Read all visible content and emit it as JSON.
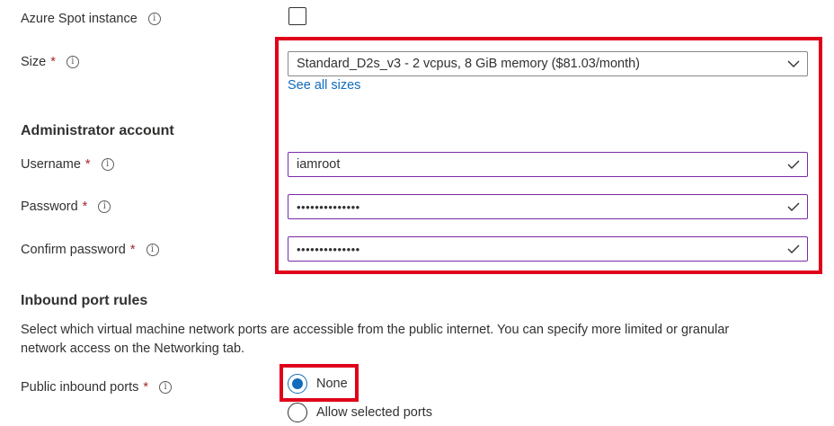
{
  "spot": {
    "label": "Azure Spot instance",
    "checked": false
  },
  "size": {
    "label": "Size",
    "required": "*",
    "value": "Standard_D2s_v3 - 2 vcpus, 8 GiB memory ($81.03/month)",
    "see_all": "See all sizes"
  },
  "admin": {
    "heading": "Administrator account",
    "username": {
      "label": "Username",
      "required": "*",
      "value": "iamroot"
    },
    "password": {
      "label": "Password",
      "required": "*",
      "value": "••••••••••••••"
    },
    "confirm": {
      "label": "Confirm password",
      "required": "*",
      "value": "••••••••••••••"
    }
  },
  "inbound": {
    "heading": "Inbound port rules",
    "description_line1": "Select which virtual machine network ports are accessible from the public internet. You can specify more limited or granular",
    "description_line2": "network access on the Networking tab.",
    "public_ports": {
      "label": "Public inbound ports",
      "required": "*",
      "options": [
        {
          "label": "None",
          "selected": true
        },
        {
          "label": "Allow selected ports",
          "selected": false
        }
      ]
    }
  },
  "colors": {
    "highlight": "#e0001b",
    "accent": "#0f6cbd",
    "required": "#a4262c",
    "field_border": "#7a2ba6"
  },
  "icons": {
    "info": "info-icon",
    "chevron": "chevron-down-icon",
    "check": "checkmark-icon"
  }
}
